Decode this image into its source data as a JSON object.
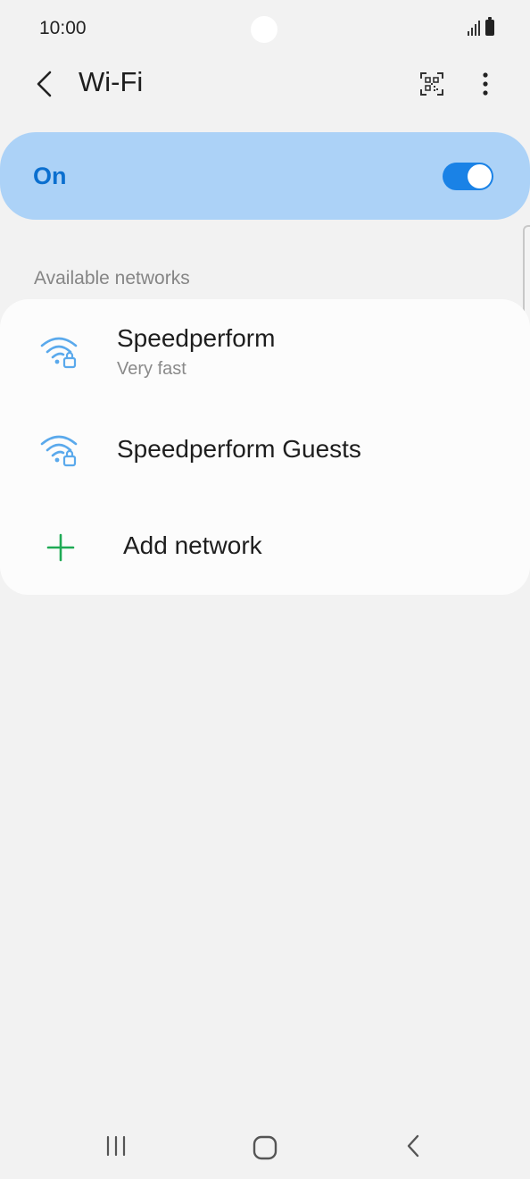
{
  "status_bar": {
    "time": "10:00"
  },
  "app_bar": {
    "title": "Wi-Fi",
    "back_icon": "chevron-left-icon",
    "qr_icon": "qr-code-scan-icon",
    "more_icon": "more-vertical-icon"
  },
  "master_toggle": {
    "label": "On",
    "state": true,
    "color": "#1a82e6",
    "card_color": "#acd2f7",
    "label_color": "#0b6fcf"
  },
  "networks_section": {
    "header": "Available networks",
    "items": [
      {
        "name": "Speedperform",
        "subtitle": "Very fast",
        "icon": "wifi-locked-icon"
      },
      {
        "name": "Speedperform Guests",
        "subtitle": "",
        "icon": "wifi-locked-icon"
      }
    ],
    "add_network": {
      "label": "Add network",
      "icon": "plus-icon",
      "icon_color": "#1faa55"
    }
  },
  "wifi_icon_color": "#5aa9ec",
  "nav_bar": {
    "recents_icon": "recents-icon",
    "home_icon": "home-icon",
    "back_icon": "back-icon"
  }
}
